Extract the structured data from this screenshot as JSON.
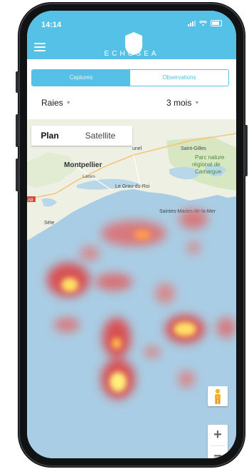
{
  "status_bar": {
    "time": "14:14"
  },
  "header": {
    "brand": "ECHOSEA"
  },
  "tabs": [
    {
      "label": "Captures",
      "active": true
    },
    {
      "label": "Observations",
      "active": false
    }
  ],
  "filters": {
    "species": "Raies",
    "period": "3 mois"
  },
  "map": {
    "type_toggle": {
      "plan": "Plan",
      "satellite": "Satellite",
      "selected": "Plan"
    },
    "labels": {
      "montpellier": "Montpellier",
      "lattes": "Lattes",
      "grau": "Le Grau-du-Roi",
      "saintgilles": "Saint-Gilles",
      "lunel": "unel",
      "parc1": "Parc nature",
      "parc2": "régional de",
      "parc3": "Camargue",
      "saintes": "Saintes-Maries-de-la-Mer",
      "sete": "Sète",
      "road": "A9"
    },
    "zoom_in": "+",
    "zoom_out": "−"
  },
  "colors": {
    "brand": "#55c1e7",
    "sea": "#a9cde4",
    "land": "#eef0e4",
    "heat_hot": "#fff07a",
    "heat_warm": "#e53935"
  }
}
